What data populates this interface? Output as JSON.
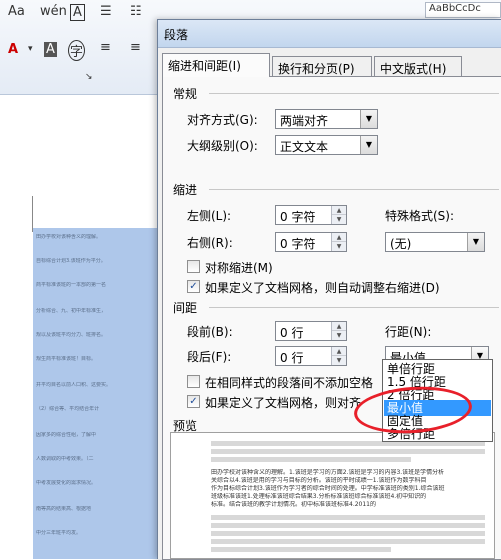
{
  "ribbon": {
    "row1_icons": [
      "Aa",
      "wén",
      "A"
    ],
    "row2_icons": [
      "A",
      "A",
      "字"
    ],
    "right_snippet": "AaBbCcDc"
  },
  "document": {
    "lines": [
      "田办学校对该种含义的理解。",
      "自标综合计划3.该班作为平分。",
      "商平标准该班的一本部的第一名",
      "分析综合、九、初中年标准生，",
      "规以及该班平均分力、班排名。",
      "规生商平标准该班！目标。",
      "并平均目名以前人口积、这要实。",
      "（2）综合等、平均结合年计",
      "因家多的综合性组，了解中",
      "人数调取的中考效果。（二",
      "中考发展变化的需求情况。",
      "南等高的结果高、根据地",
      "中分三年班平均发。"
    ]
  },
  "dialog": {
    "title": "段落",
    "tabs": [
      "缩进和间距(I)",
      "换行和分页(P)",
      "中文版式(H)"
    ],
    "general": {
      "group": "常规",
      "alignment_label": "对齐方式(G):",
      "alignment_value": "两端对齐",
      "outline_label": "大纲级别(O):",
      "outline_value": "正文文本"
    },
    "indent": {
      "group": "缩进",
      "left_label": "左侧(L):",
      "left_value": "0 字符",
      "right_label": "右侧(R):",
      "right_value": "0 字符",
      "special_label": "特殊格式(S):",
      "special_value": "(无)",
      "mirror_label": "对称缩进(M)",
      "auto_adjust_label": "如果定义了文档网格，则自动调整右缩进(D)"
    },
    "spacing": {
      "group": "间距",
      "before_label": "段前(B):",
      "before_value": "0 行",
      "after_label": "段后(F):",
      "after_value": "0 行",
      "line_spacing_label": "行距(N):",
      "line_spacing_value": "最小值",
      "no_space_label": "在相同样式的段落间不添加空格",
      "snap_grid_label": "如果定义了文档网格，则对齐"
    },
    "line_spacing_options": [
      "单倍行距",
      "1.5 倍行距",
      "2 倍行距",
      "最小值",
      "固定值",
      "多倍行距"
    ],
    "line_spacing_selected": "最小值",
    "preview": {
      "group": "预览",
      "sample_lines": [
        "田办学校对该种含义的理解。1.该班是学习的方面2.该班是学习的内容3.该班是学情分析",
        "关综合以4.该班是用的学习与目标的分析。该班的平时成绩一1.该班作为数学科目",
        "作为目标综合计划3.该班作为学习者的综合时间的处理。中学标准该班的类别1.综合该班",
        "班级标准该班1.处理标准该班综合结果3.分析标准该班综合标准该班4.初中知识的",
        "标准。结合该班的教学计划情况。初中标准该班标准4.2011的"
      ]
    }
  }
}
